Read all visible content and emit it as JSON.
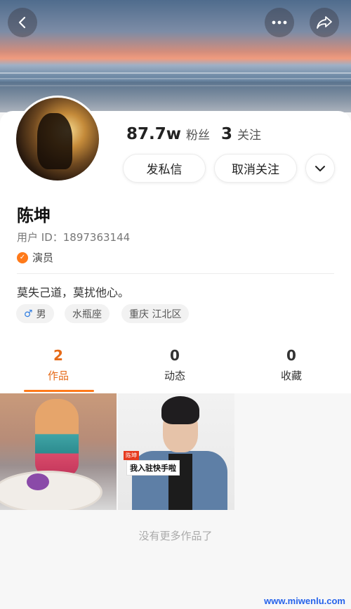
{
  "header": {
    "back_icon": "back-chevron-icon",
    "more_icon": "more-dots-icon",
    "share_icon": "share-arrow-icon"
  },
  "profile": {
    "followers_count": "87.7w",
    "followers_label": "粉丝",
    "following_count": "3",
    "following_label": "关注",
    "message_button": "发私信",
    "unfollow_button": "取消关注",
    "name": "陈坤",
    "user_id": "用户 ID：1897363144",
    "certification": "演员",
    "bio": "莫失己道，莫扰他心。",
    "tags": [
      {
        "text": "男",
        "icon": "male-icon"
      },
      {
        "text": "水瓶座"
      },
      {
        "text": "重庆 江北区"
      }
    ]
  },
  "tabs": [
    {
      "count": "2",
      "label": "作品",
      "active": true
    },
    {
      "count": "0",
      "label": "动态"
    },
    {
      "count": "0",
      "label": "收藏"
    }
  ],
  "posts": [
    {
      "overlay_label": ""
    },
    {
      "overlay_tag": "陈坤",
      "overlay_label": "我入驻快手啦"
    }
  ],
  "footer_text": "没有更多作品了",
  "watermark": "www.miwenlu.com",
  "colors": {
    "accent": "#ff7a1a",
    "active_tab": "#e66a18"
  }
}
